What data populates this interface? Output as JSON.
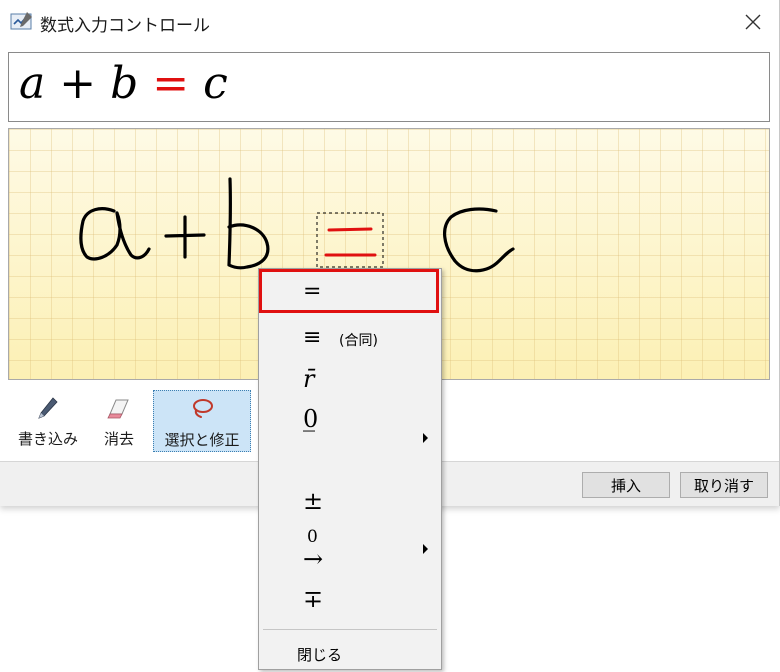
{
  "window": {
    "title": "数式入力コントロール"
  },
  "preview": {
    "a": "a",
    "plus": "+",
    "b": "b",
    "equals": "=",
    "c": "c"
  },
  "tools": {
    "write": "書き込み",
    "erase": "消去",
    "select": "選択と修正"
  },
  "buttons": {
    "insert": "挿入",
    "cancel": "取り消す"
  },
  "menu": {
    "items": [
      {
        "symbol": "="
      },
      {
        "symbol": "≡",
        "note": "(合同)"
      },
      {
        "symbol": "r̄"
      },
      {
        "symbol_top": "0",
        "symbol_bottom": "‾"
      },
      {
        "symbol": "±"
      },
      {
        "symbol_top": "0",
        "symbol_bottom": "→"
      },
      {
        "symbol": "∓"
      }
    ],
    "close": "閉じる"
  },
  "colors": {
    "accent_red": "#e01010",
    "selected_tool_bg": "#cce4f7",
    "canvas_yellow": "#fdf5c0"
  }
}
